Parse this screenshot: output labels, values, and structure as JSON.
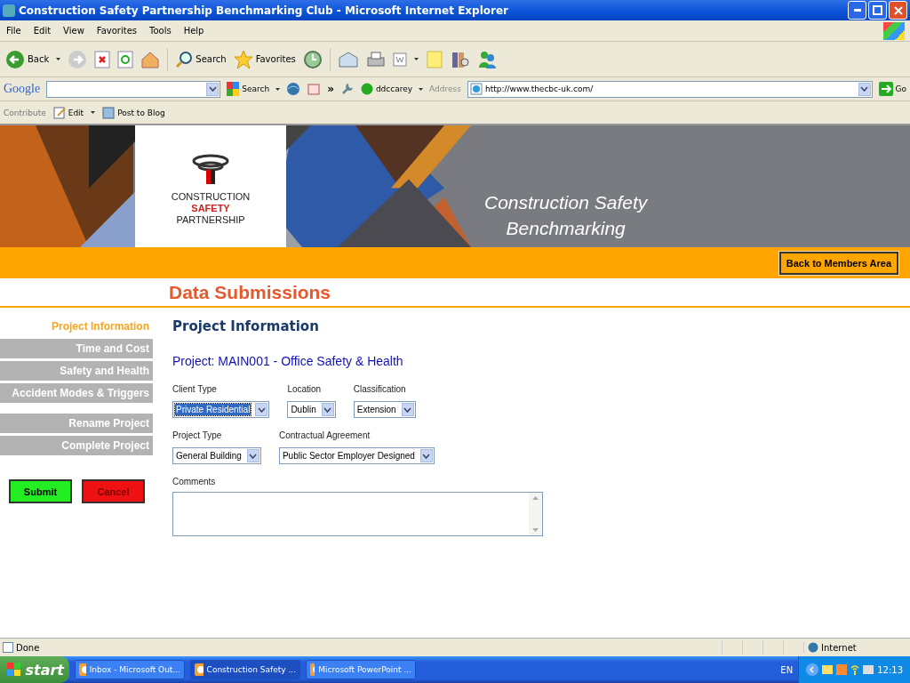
{
  "window": {
    "title": "Construction Safety Partnership Benchmarking Club - Microsoft Internet Explorer"
  },
  "menu": [
    "File",
    "Edit",
    "View",
    "Favorites",
    "Tools",
    "Help"
  ],
  "toolbar": {
    "back": "Back",
    "search": "Search",
    "favorites": "Favorites"
  },
  "google_bar": {
    "logo": "Google",
    "search": "Search",
    "more": "»",
    "user": "ddccarey"
  },
  "address_bar": {
    "label": "Address",
    "url": "http://www.thecbc-uk.com/",
    "go": "Go"
  },
  "links_bar": {
    "label": "Contribute",
    "edit": "Edit",
    "post": "Post to Blog"
  },
  "banner": {
    "logo_lines": [
      {
        "text": "CONSTRUCTION",
        "kind": "plain"
      },
      {
        "text": "SAFETY",
        "kind": "accent"
      },
      {
        "text": "PARTNERSHIP",
        "kind": "plain"
      }
    ],
    "tagline": [
      "Construction Safety",
      "Benchmarking"
    ]
  },
  "back_button": "Back to Members Area",
  "page_heading": "Data Submissions",
  "sidebar": {
    "sections": [
      {
        "label": "Project Information",
        "selected": true
      },
      {
        "label": "Time and Cost",
        "selected": false
      },
      {
        "label": "Safety and Health",
        "selected": false
      },
      {
        "label": "Accident Modes & Triggers",
        "selected": false
      }
    ],
    "actions": [
      {
        "label": "Rename Project",
        "selected": false
      },
      {
        "label": "Complete Project",
        "selected": false
      }
    ],
    "buttons": [
      {
        "label": "Submit",
        "kind": "submit"
      },
      {
        "label": "Cancel",
        "kind": "cancel"
      }
    ]
  },
  "form": {
    "title": "Project Information",
    "project": "Project: MAIN001 - Office Safety & Health",
    "rows": [
      [
        {
          "label": "Client Type",
          "value": "Private Residential",
          "focused": true
        },
        {
          "label": "Location",
          "value": "Dublin",
          "focused": false
        },
        {
          "label": "Classification",
          "value": "Extension",
          "focused": false
        }
      ],
      [
        {
          "label": "Project Type",
          "value": "General Building",
          "focused": false
        },
        {
          "label": "Contractual Agreement",
          "value": "Public Sector Employer Designed",
          "focused": false
        }
      ]
    ],
    "comments_label": "Comments"
  },
  "status_bar": {
    "text": "Done",
    "zone": "Internet"
  },
  "taskbar": {
    "start": "start",
    "tasks": [
      {
        "label": "Inbox - Microsoft Out...",
        "selected": false
      },
      {
        "label": "Construction Safety ...",
        "selected": true
      },
      {
        "label": "Microsoft PowerPoint ...",
        "selected": false
      }
    ],
    "language": "EN",
    "time": "12:13"
  }
}
